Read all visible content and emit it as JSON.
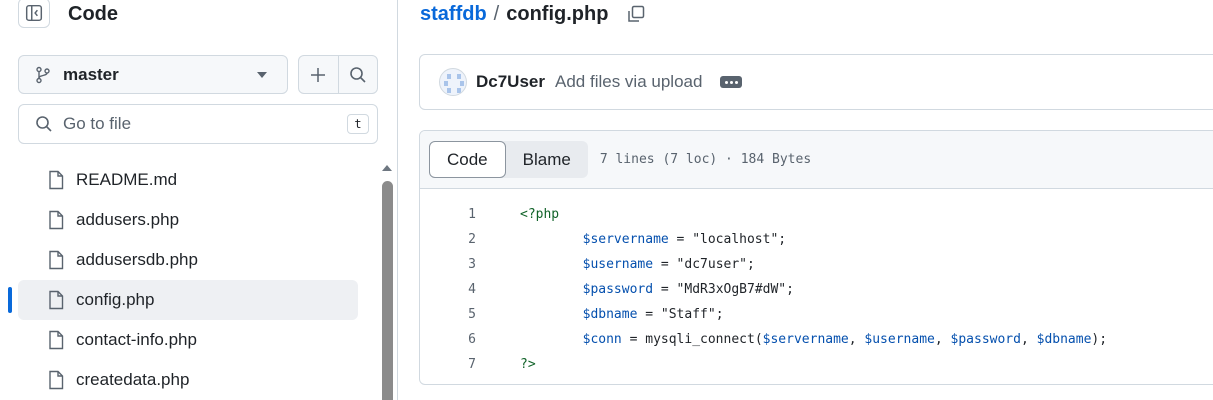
{
  "sidebar": {
    "title": "Code",
    "branch": "master",
    "goto_placeholder": "Go to file",
    "goto_shortcut": "t",
    "files": [
      {
        "name": "README.md",
        "active": false
      },
      {
        "name": "addusers.php",
        "active": false
      },
      {
        "name": "addusersdb.php",
        "active": false
      },
      {
        "name": "config.php",
        "active": true
      },
      {
        "name": "contact-info.php",
        "active": false
      },
      {
        "name": "createdata.php",
        "active": false
      }
    ]
  },
  "breadcrumb": {
    "repo": "staffdb",
    "separator": "/",
    "file": "config.php"
  },
  "commit": {
    "user": "Dc7User",
    "message": "Add files via upload"
  },
  "code_view": {
    "tabs": [
      "Code",
      "Blame"
    ],
    "selected_tab": "Code",
    "meta": "7 lines (7 loc) · 184 Bytes",
    "lines": [
      {
        "num": "1",
        "text": "<?php"
      },
      {
        "num": "2",
        "text": "        $servername = \"localhost\";"
      },
      {
        "num": "3",
        "text": "        $username = \"dc7user\";"
      },
      {
        "num": "4",
        "text": "        $password = \"MdR3xOgB7#dW\";"
      },
      {
        "num": "5",
        "text": "        $dbname = \"Staff\";"
      },
      {
        "num": "6",
        "text": "        $conn = mysqli_connect($servername, $username, $password, $dbname);"
      },
      {
        "num": "7",
        "text": "?>"
      }
    ]
  },
  "colors": {
    "accent": "#0969da",
    "border": "#d1d9e0",
    "muted": "#59636e"
  }
}
